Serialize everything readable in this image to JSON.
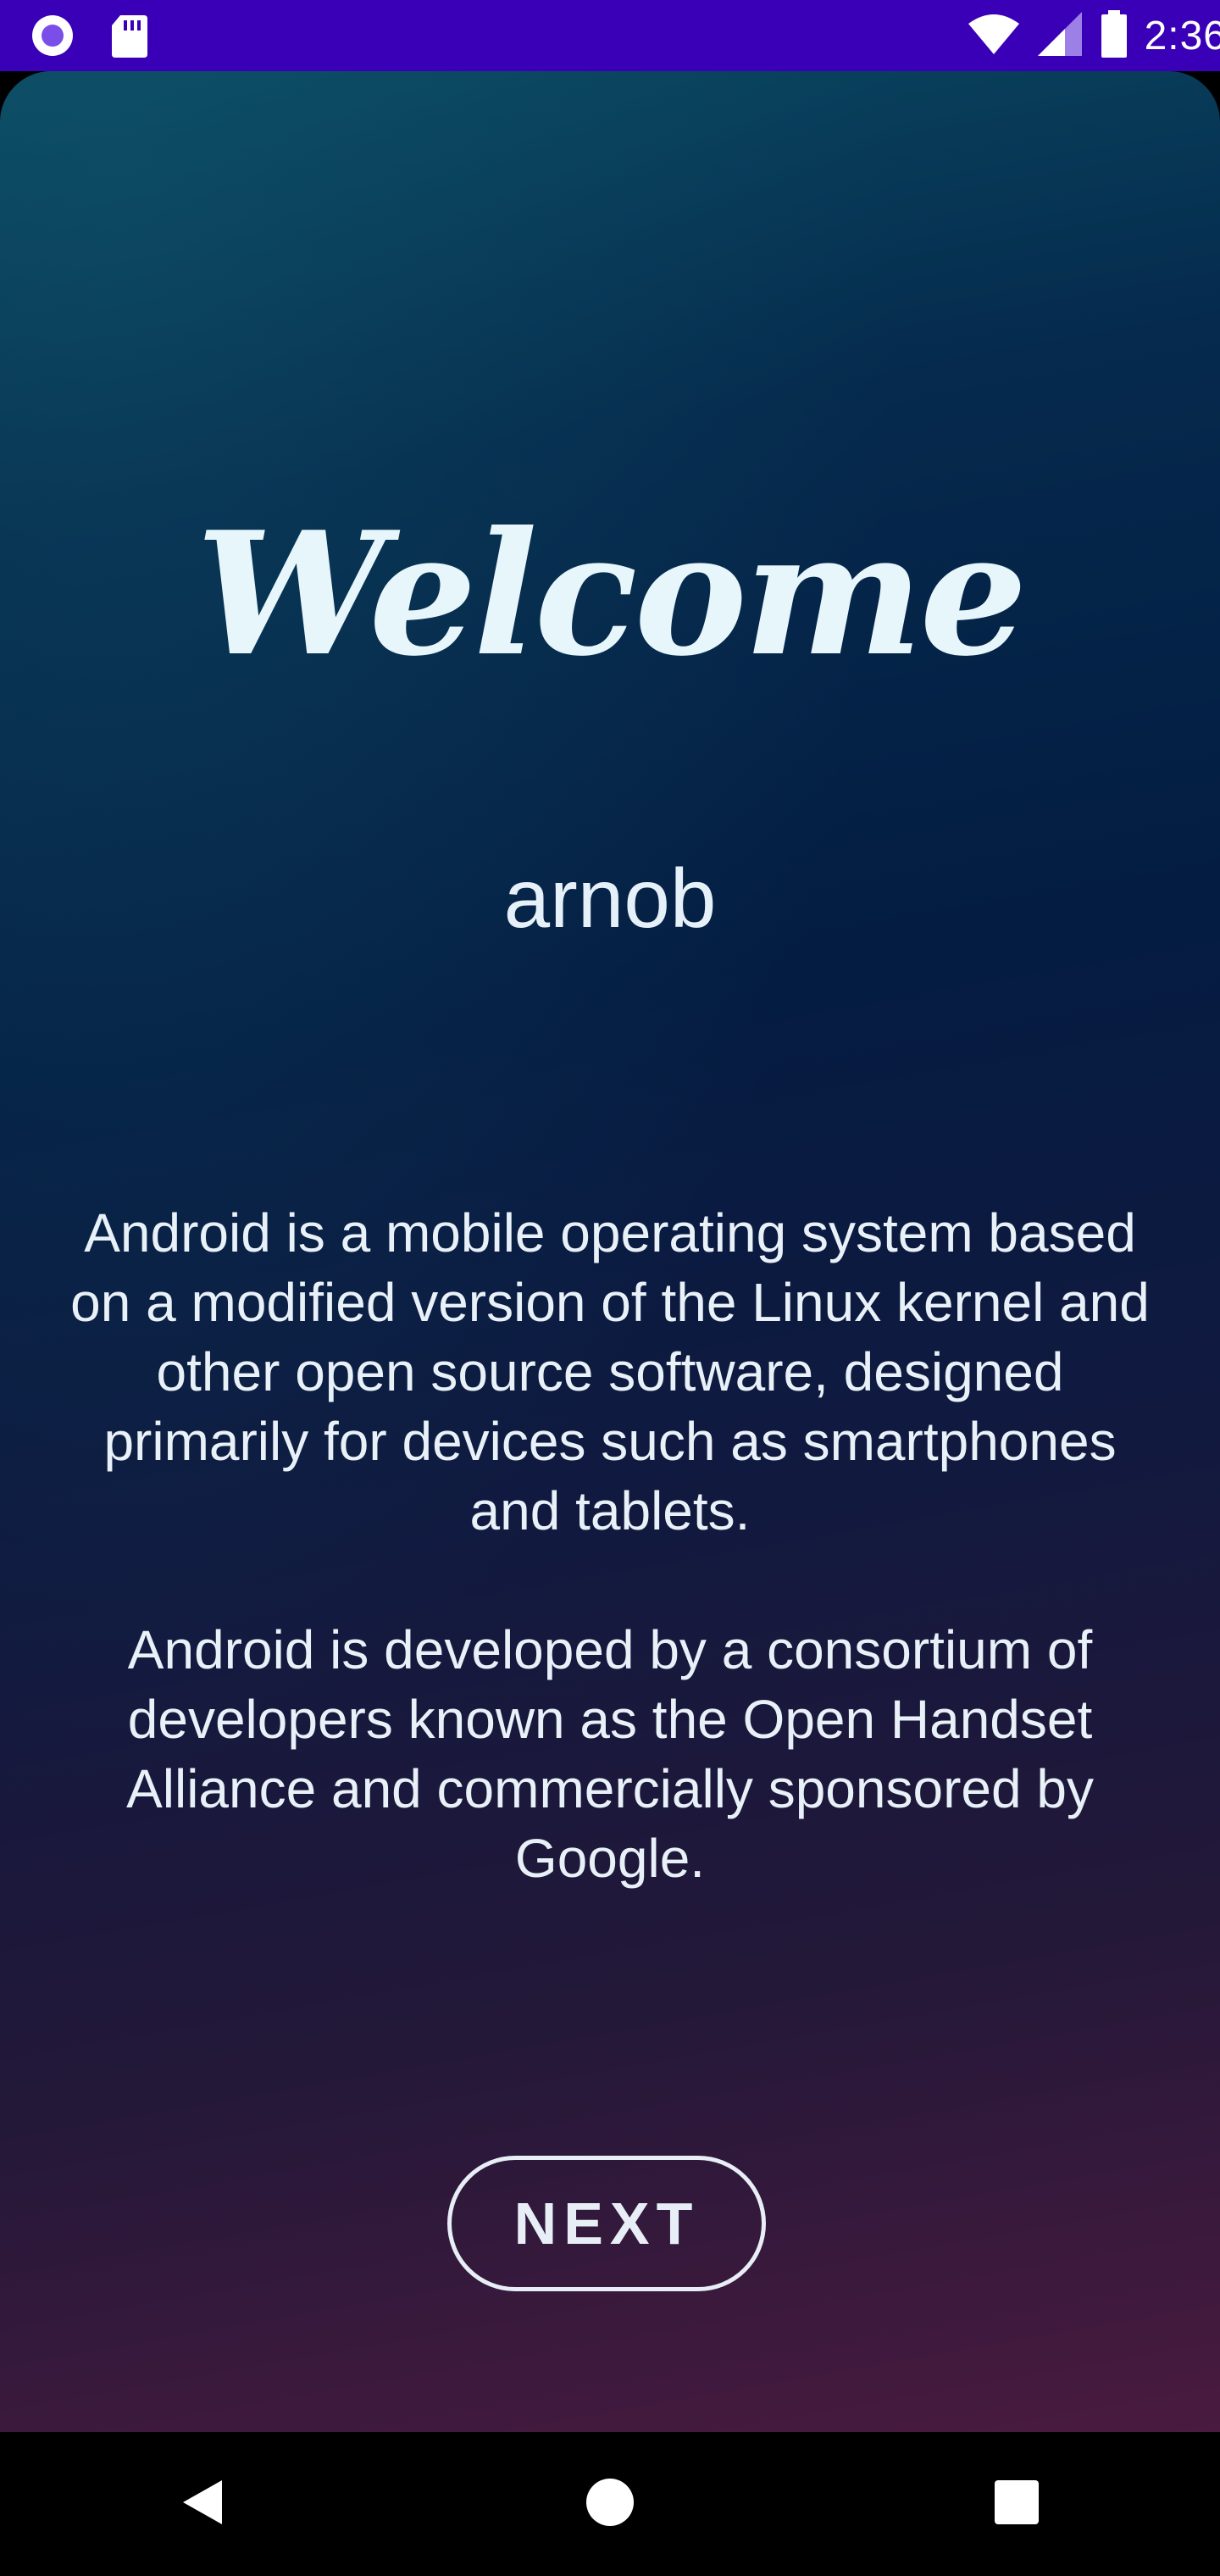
{
  "status_bar": {
    "time": "2:36",
    "background_color": "#3a00b8",
    "icons": [
      "app-notification-icon",
      "sd-card-icon",
      "wifi-icon",
      "cellular-signal-icon",
      "battery-icon"
    ]
  },
  "screen": {
    "welcome_title": "Welcome",
    "username": "arnob",
    "paragraphs": [
      "Android is a mobile operating system based on a modified version of the Linux kernel and other open source software, designed primarily for devices such as smartphones and tablets.",
      "Android is developed by a consortium of developers known as the Open Handset Alliance and commercially sponsored by Google."
    ],
    "next_label": "NEXT"
  },
  "nav_bar": {
    "icons": [
      "back-icon",
      "home-icon",
      "recents-icon"
    ]
  }
}
